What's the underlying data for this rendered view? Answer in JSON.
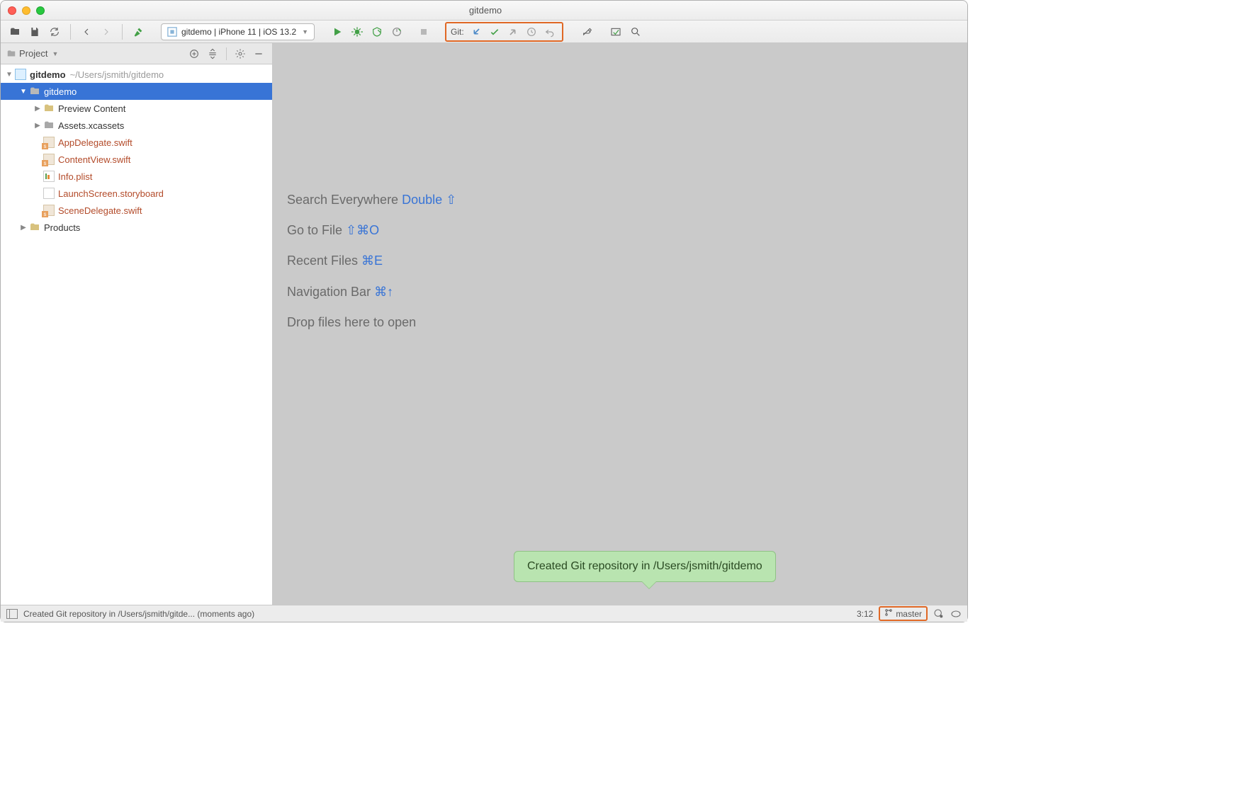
{
  "window": {
    "title": "gitdemo"
  },
  "toolbar": {
    "runConfig": "gitdemo | iPhone 11 | iOS 13.2",
    "gitLabel": "Git:"
  },
  "sidebar": {
    "title": "Project",
    "root": {
      "name": "gitdemo",
      "path": "~/Users/jsmith/gitdemo"
    },
    "tree": {
      "project": "gitdemo",
      "preview": "Preview Content",
      "assets": "Assets.xcassets",
      "appDelegate": "AppDelegate.swift",
      "contentView": "ContentView.swift",
      "infoPlist": "Info.plist",
      "launchScreen": "LaunchScreen.storyboard",
      "sceneDelegate": "SceneDelegate.swift",
      "products": "Products"
    }
  },
  "editor": {
    "hints": {
      "searchLabel": "Search Everywhere ",
      "searchKey": "Double ⇧",
      "gotoLabel": "Go to File ",
      "gotoKey": "⇧⌘O",
      "recentLabel": "Recent Files ",
      "recentKey": "⌘E",
      "navLabel": "Navigation Bar ",
      "navKey": "⌘↑",
      "drop": "Drop files here to open"
    }
  },
  "tooltip": "Created Git repository in /Users/jsmith/gitdemo",
  "statusbar": {
    "message": "Created Git repository in /Users/jsmith/gitde... (moments ago)",
    "position": "3:12",
    "branch": "master"
  }
}
